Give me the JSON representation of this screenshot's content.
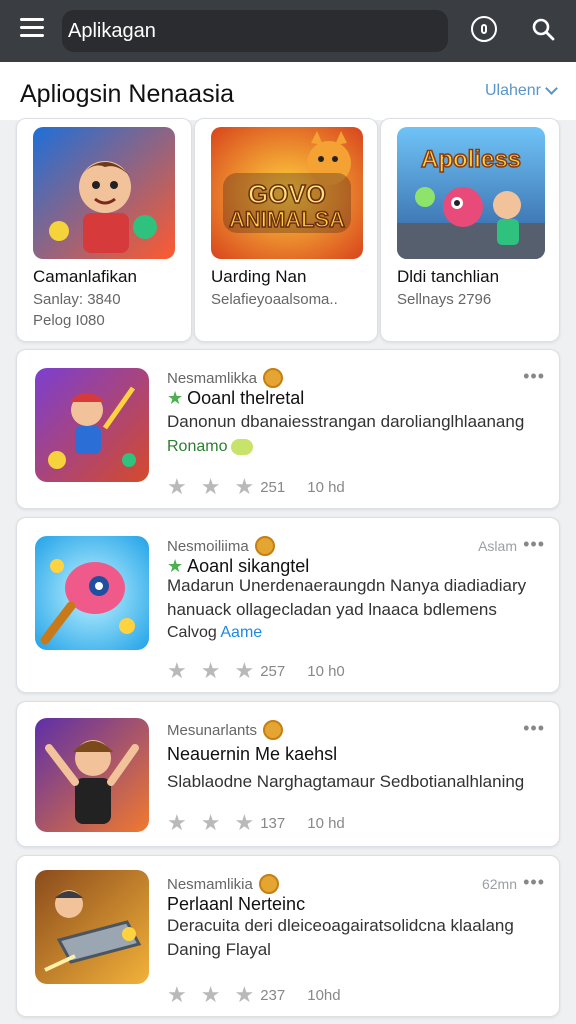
{
  "topbar": {
    "search_text": "Aplikagan"
  },
  "section": {
    "title": "Apliogsin Nenaasia",
    "more_label": "Ulahenr"
  },
  "featured": [
    {
      "name": "Camanlafikan",
      "line1": "Sanlay: 3840",
      "line2": "Pelog I080",
      "thumb_text": "",
      "colors": [
        "#1e6fd9",
        "#ff5a2e"
      ]
    },
    {
      "name": "Uarding Nan",
      "line1": "Selafieyoaalsoma..",
      "line2": "",
      "thumb_text": "GOVO ANIMALSA",
      "colors": [
        "#f0a423",
        "#d8451d"
      ]
    },
    {
      "name": "Dldi tanchlian",
      "line1": "Sellnays 2796",
      "line2": "",
      "thumb_text": "Apoliess",
      "colors": [
        "#3a7bd5",
        "#6fc3f7"
      ]
    }
  ],
  "rows": [
    {
      "developer": "Nesmamlikka",
      "time": "",
      "title": "Ooanl thelretal",
      "desc": "Danonun dbanaiesstrangan darolianglhlaanang",
      "sub": "Ronamo",
      "rating": "251",
      "downloads": "10 hd",
      "colors": [
        "#7b3fd1",
        "#d54a2a"
      ]
    },
    {
      "developer": "Nesmoiliima",
      "time": "Aslam",
      "title": "Aoanl sikangtel",
      "desc": "Madarun Unerdenaeraungdn Nanya diadiadiary hanuack ollagecladan yad lnaaca bdlemens",
      "sub_a": "Calvog",
      "sub_b": "Aame",
      "rating": "257",
      "downloads": "10 h0",
      "colors": [
        "#23a3e8",
        "#f05a8a"
      ]
    },
    {
      "developer": "Mesunarlants",
      "time": "",
      "title": "Neauernin Me kaehsl",
      "desc": "Slablaodne Narghagtamaur Sedbotianalhlaning",
      "rating": "137",
      "downloads": "10 hd",
      "colors": [
        "#5d2fa8",
        "#f07a2e"
      ]
    },
    {
      "developer": "Nesmamlikia",
      "time": "62mn",
      "title": "Perlaanl Nerteinc",
      "desc": "Deracuita deri dleiceoagairatsolidcna klaalang Daning Flayal",
      "rating": "237",
      "downloads": "10hd",
      "colors": [
        "#8a4b1c",
        "#f3b23a"
      ]
    }
  ],
  "icons": {
    "menu": "hamburger-menu-icon",
    "mic": "microphone-icon",
    "search": "search-icon",
    "chevron": "chevron-down-icon",
    "verified": "verified-badge-icon",
    "more": "more-options-icon",
    "star": "star-icon"
  }
}
